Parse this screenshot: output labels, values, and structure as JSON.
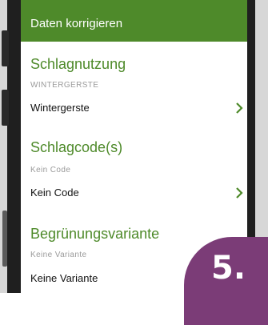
{
  "header": {
    "title": "Daten korrigieren"
  },
  "sections": [
    {
      "title": "Schlagnutzung",
      "subtitle": "WINTERGERSTE",
      "value": "Wintergerste"
    },
    {
      "title": "Schlagcode(s)",
      "subtitle": "Kein Code",
      "value": "Kein Code"
    },
    {
      "title": "Begrünungsvariante",
      "subtitle": "Keine Variante",
      "value": "Keine Variante"
    }
  ],
  "badge": {
    "label": "5."
  },
  "colors": {
    "accent": "#4e8a2a",
    "badge": "#7b3c77"
  },
  "icons": {
    "row_action": "chevron-right-icon"
  }
}
